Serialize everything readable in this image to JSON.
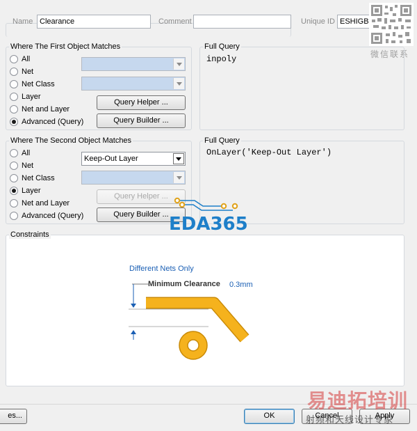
{
  "header": {
    "name_label": "Name",
    "name_value": "Clearance",
    "comment_label": "Comment",
    "comment_value": "",
    "uid_label": "Unique ID",
    "uid_value": "ESHIGBBB"
  },
  "first_match": {
    "title": "Where The First Object Matches",
    "options": [
      "All",
      "Net",
      "Net Class",
      "Layer",
      "Net and Layer",
      "Advanced (Query)"
    ],
    "selected": "Advanced (Query)",
    "query_helper": "Query Helper ...",
    "query_builder": "Query Builder ..."
  },
  "first_query": {
    "title": "Full Query",
    "text": "inpoly"
  },
  "second_match": {
    "title": "Where The Second Object Matches",
    "options": [
      "All",
      "Net",
      "Net Class",
      "Layer",
      "Net and Layer",
      "Advanced (Query)"
    ],
    "selected": "Layer",
    "layer_value": "Keep-Out Layer",
    "query_helper": "Query Helper ...",
    "query_builder": "Query Builder ..."
  },
  "second_query": {
    "title": "Full Query",
    "text": "OnLayer('Keep-Out Layer')"
  },
  "constraints": {
    "title": "Constraints",
    "net_scope": "Different Nets Only",
    "min_clearance_label": "Minimum Clearance",
    "min_clearance_value": "0.3mm"
  },
  "footer": {
    "left_button": "es...",
    "ok": "OK",
    "cancel": "Cancel",
    "apply": "Apply"
  },
  "watermarks": {
    "eda": "EDA365",
    "qr_caption": "微信联系",
    "brand_main": "易迪拓培训",
    "brand_sub": "射频和天线设计专家"
  },
  "colors": {
    "track": "#f5b21d",
    "track_edge": "#c98a07",
    "dim_blue": "#1a5fb4",
    "eda_blue": "#1e7fc9"
  }
}
